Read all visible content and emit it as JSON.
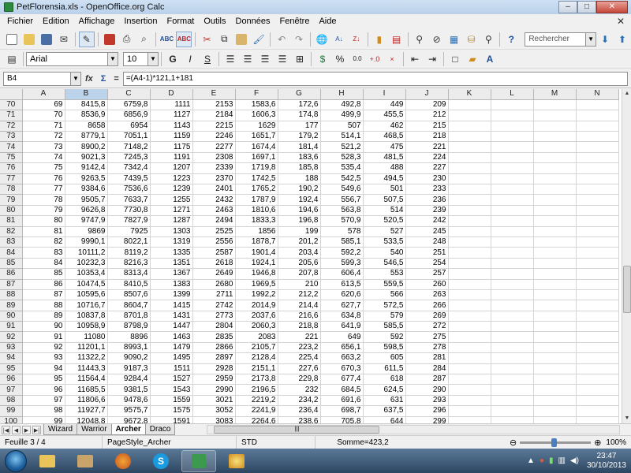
{
  "window": {
    "title": "PetFlorensia.xls - OpenOffice.org Calc",
    "buttons": {
      "minimize": "–",
      "maximize": "□",
      "close": "✕"
    }
  },
  "menu": [
    "Fichier",
    "Edition",
    "Affichage",
    "Insertion",
    "Format",
    "Outils",
    "Données",
    "Fenêtre",
    "Aide"
  ],
  "toolbar": {
    "search_placeholder": "Rechercher"
  },
  "format": {
    "font_name": "Arial",
    "font_size": "10",
    "bold": "G",
    "italic": "I",
    "underline": "S"
  },
  "formula": {
    "cell_ref": "B4",
    "fx": "fx",
    "sum": "Σ",
    "equals": "=",
    "content": "=(A4-1)*121,1+181"
  },
  "grid": {
    "columns": [
      "A",
      "B",
      "C",
      "D",
      "E",
      "F",
      "G",
      "H",
      "I",
      "J",
      "K",
      "L",
      "M",
      "N"
    ],
    "rows": [
      [
        "70",
        "69",
        "8415,8",
        "6759,8",
        "1111",
        "2153",
        "1583,6",
        "172,6",
        "492,8",
        "449",
        "209"
      ],
      [
        "71",
        "70",
        "8536,9",
        "6856,9",
        "1127",
        "2184",
        "1606,3",
        "174,8",
        "499,9",
        "455,5",
        "212"
      ],
      [
        "72",
        "71",
        "8658",
        "6954",
        "1143",
        "2215",
        "1629",
        "177",
        "507",
        "462",
        "215"
      ],
      [
        "73",
        "72",
        "8779,1",
        "7051,1",
        "1159",
        "2246",
        "1651,7",
        "179,2",
        "514,1",
        "468,5",
        "218"
      ],
      [
        "74",
        "73",
        "8900,2",
        "7148,2",
        "1175",
        "2277",
        "1674,4",
        "181,4",
        "521,2",
        "475",
        "221"
      ],
      [
        "75",
        "74",
        "9021,3",
        "7245,3",
        "1191",
        "2308",
        "1697,1",
        "183,6",
        "528,3",
        "481,5",
        "224"
      ],
      [
        "76",
        "75",
        "9142,4",
        "7342,4",
        "1207",
        "2339",
        "1719,8",
        "185,8",
        "535,4",
        "488",
        "227"
      ],
      [
        "77",
        "76",
        "9263,5",
        "7439,5",
        "1223",
        "2370",
        "1742,5",
        "188",
        "542,5",
        "494,5",
        "230"
      ],
      [
        "78",
        "77",
        "9384,6",
        "7536,6",
        "1239",
        "2401",
        "1765,2",
        "190,2",
        "549,6",
        "501",
        "233"
      ],
      [
        "79",
        "78",
        "9505,7",
        "7633,7",
        "1255",
        "2432",
        "1787,9",
        "192,4",
        "556,7",
        "507,5",
        "236"
      ],
      [
        "80",
        "79",
        "9626,8",
        "7730,8",
        "1271",
        "2463",
        "1810,6",
        "194,6",
        "563,8",
        "514",
        "239"
      ],
      [
        "81",
        "80",
        "9747,9",
        "7827,9",
        "1287",
        "2494",
        "1833,3",
        "196,8",
        "570,9",
        "520,5",
        "242"
      ],
      [
        "82",
        "81",
        "9869",
        "7925",
        "1303",
        "2525",
        "1856",
        "199",
        "578",
        "527",
        "245"
      ],
      [
        "83",
        "82",
        "9990,1",
        "8022,1",
        "1319",
        "2556",
        "1878,7",
        "201,2",
        "585,1",
        "533,5",
        "248"
      ],
      [
        "84",
        "83",
        "10111,2",
        "8119,2",
        "1335",
        "2587",
        "1901,4",
        "203,4",
        "592,2",
        "540",
        "251"
      ],
      [
        "85",
        "84",
        "10232,3",
        "8216,3",
        "1351",
        "2618",
        "1924,1",
        "205,6",
        "599,3",
        "546,5",
        "254"
      ],
      [
        "86",
        "85",
        "10353,4",
        "8313,4",
        "1367",
        "2649",
        "1946,8",
        "207,8",
        "606,4",
        "553",
        "257"
      ],
      [
        "87",
        "86",
        "10474,5",
        "8410,5",
        "1383",
        "2680",
        "1969,5",
        "210",
        "613,5",
        "559,5",
        "260"
      ],
      [
        "88",
        "87",
        "10595,6",
        "8507,6",
        "1399",
        "2711",
        "1992,2",
        "212,2",
        "620,6",
        "566",
        "263"
      ],
      [
        "89",
        "88",
        "10716,7",
        "8604,7",
        "1415",
        "2742",
        "2014,9",
        "214,4",
        "627,7",
        "572,5",
        "266"
      ],
      [
        "90",
        "89",
        "10837,8",
        "8701,8",
        "1431",
        "2773",
        "2037,6",
        "216,6",
        "634,8",
        "579",
        "269"
      ],
      [
        "91",
        "90",
        "10958,9",
        "8798,9",
        "1447",
        "2804",
        "2060,3",
        "218,8",
        "641,9",
        "585,5",
        "272"
      ],
      [
        "92",
        "91",
        "11080",
        "8896",
        "1463",
        "2835",
        "2083",
        "221",
        "649",
        "592",
        "275"
      ],
      [
        "93",
        "92",
        "11201,1",
        "8993,1",
        "1479",
        "2866",
        "2105,7",
        "223,2",
        "656,1",
        "598,5",
        "278"
      ],
      [
        "94",
        "93",
        "11322,2",
        "9090,2",
        "1495",
        "2897",
        "2128,4",
        "225,4",
        "663,2",
        "605",
        "281"
      ],
      [
        "95",
        "94",
        "11443,3",
        "9187,3",
        "1511",
        "2928",
        "2151,1",
        "227,6",
        "670,3",
        "611,5",
        "284"
      ],
      [
        "96",
        "95",
        "11564,4",
        "9284,4",
        "1527",
        "2959",
        "2173,8",
        "229,8",
        "677,4",
        "618",
        "287"
      ],
      [
        "97",
        "96",
        "11685,5",
        "9381,5",
        "1543",
        "2990",
        "2196,5",
        "232",
        "684,5",
        "624,5",
        "290"
      ],
      [
        "98",
        "97",
        "11806,6",
        "9478,6",
        "1559",
        "3021",
        "2219,2",
        "234,2",
        "691,6",
        "631",
        "293"
      ],
      [
        "99",
        "98",
        "11927,7",
        "9575,7",
        "1575",
        "3052",
        "2241,9",
        "236,4",
        "698,7",
        "637,5",
        "296"
      ],
      [
        "100",
        "99",
        "12048,8",
        "9672,8",
        "1591",
        "3083",
        "2264,6",
        "238,6",
        "705,8",
        "644",
        "299"
      ]
    ]
  },
  "sheets": {
    "tabs": [
      "Wizard",
      "Warrior",
      "Archer",
      "Draco"
    ],
    "active": "Archer"
  },
  "status": {
    "sheet": "Feuille 3 / 4",
    "page_style": "PageStyle_Archer",
    "mode": "STD",
    "sum": "Somme=423,2",
    "zoom_minus": "⊖",
    "zoom_plus": "⊕",
    "zoom": "100%",
    "zoom_level_percent": 100
  },
  "taskbar": {
    "time": "23:47",
    "date": "30/10/2013"
  },
  "colors": {
    "selected_header": "#bcd3ec",
    "taskbar": "#2d4661"
  }
}
